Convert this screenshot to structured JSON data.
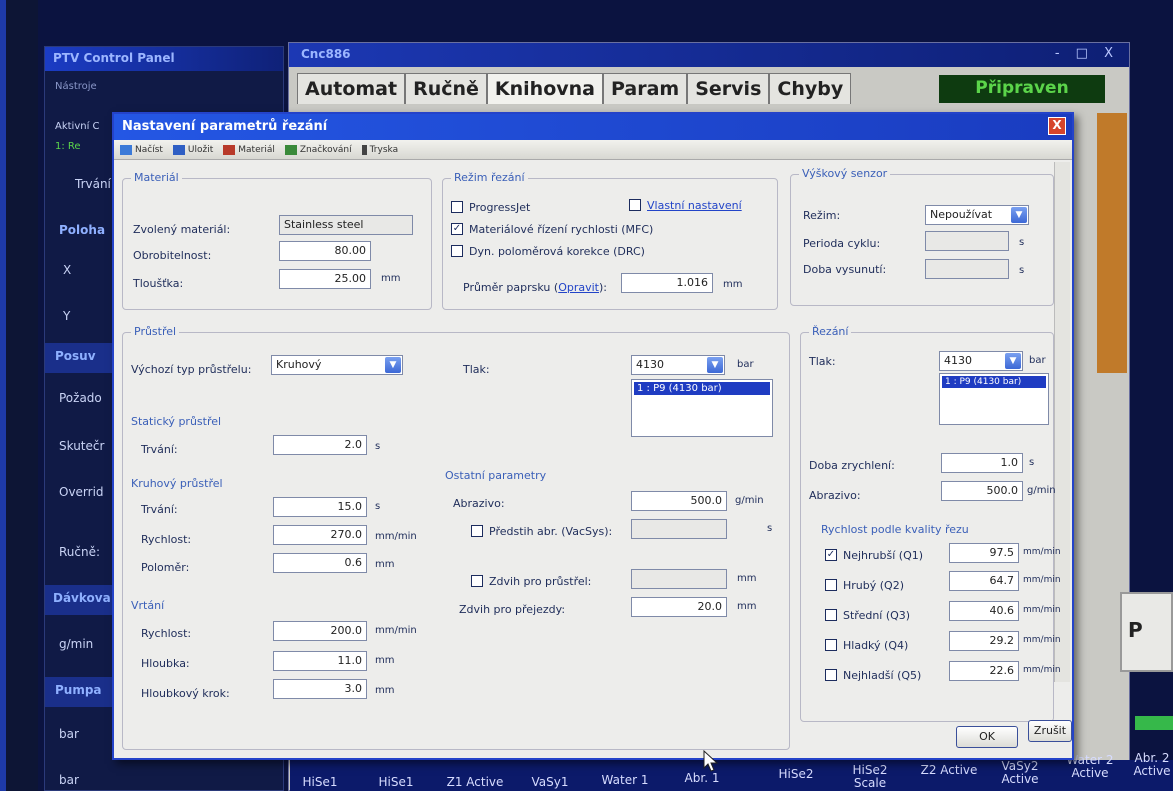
{
  "ptv": {
    "title": "PTV Control Panel",
    "rows": {
      "nastroje": "Nástroje",
      "aktivni": "Aktivní C",
      "one": "1:  Re",
      "trvani": "Trvání:",
      "poloha": "Poloha",
      "x": "X",
      "y": "Y",
      "posuv": "Posuv",
      "pozado": "Požado",
      "skutec": "Skutečr",
      "overrid": "Overrid",
      "rucne": "Ručně:",
      "davkova": "Dávkova",
      "gmin": "g/min",
      "pumpa": "Pumpa",
      "bar1": "bar",
      "bar2": "bar"
    }
  },
  "cnc": {
    "title": "Cnc886",
    "window_buttons": "- □ X",
    "tabs": [
      "Automat",
      "Ručně",
      "Knihovna",
      "Param",
      "Servis",
      "Chyby"
    ],
    "active_tab": 2,
    "status": "Připraven",
    "side_button": "P"
  },
  "bottom_bar": [
    {
      "l1": "HiSe1",
      "l2": ""
    },
    {
      "l1": "HiSe1",
      "l2": ""
    },
    {
      "l1": "Z1 Active",
      "l2": ""
    },
    {
      "l1": "VaSy1",
      "l2": ""
    },
    {
      "l1": "Water 1",
      "l2": ""
    },
    {
      "l1": "Abr. 1",
      "l2": ""
    },
    {
      "l1": "HiSe2",
      "l2": ""
    },
    {
      "l1": "HiSe2",
      "l2": "Scale"
    },
    {
      "l1": "Z2 Active",
      "l2": ""
    },
    {
      "l1": "VaSy2",
      "l2": "Active"
    },
    {
      "l1": "Water 2",
      "l2": "Active"
    },
    {
      "l1": "Abr. 2",
      "l2": "Active"
    }
  ],
  "dialog": {
    "title": "Nastavení parametrů řezání",
    "close": "X",
    "toolbar": [
      "Načíst",
      "Uložit",
      "Materiál",
      "Značkování",
      "Tryska"
    ],
    "material": {
      "legend": "Materiál",
      "zvoleny_label": "Zvolený materiál:",
      "zvoleny_value": "Stainless steel",
      "obrob_label": "Obrobitelnost:",
      "obrob_value": "80.00",
      "tloustka_label": "Tloušťka:",
      "tloustka_value": "25.00",
      "tloustka_unit": "mm"
    },
    "rezim": {
      "legend": "Režim řezání",
      "progressjet": "ProgressJet",
      "progressjet_checked": false,
      "vlastni": "Vlastní nastavení",
      "vlastni_checked": false,
      "mfc": "Materiálové řízení rychlosti (MFC)",
      "mfc_checked": true,
      "drc": "Dyn. poloměrová korekce (DRC)",
      "drc_checked": false,
      "prumer_label": "Průměr paprsku",
      "prumer_link": "Opravit",
      "prumer_value": "1.016",
      "prumer_unit": "mm"
    },
    "senzor": {
      "legend": "Výškový senzor",
      "rezim_label": "Režim:",
      "rezim_value": "Nepoužívat",
      "perioda_label": "Perioda cyklu:",
      "perioda_unit": "s",
      "doba_label": "Doba vysunutí:",
      "doba_unit": "s"
    },
    "prustrel": {
      "legend": "Průstřel",
      "typ_label": "Výchozí typ průstřelu:",
      "typ_value": "Kruhový",
      "staticky_head": "Statický průstřel",
      "st_trvani_label": "Trvání:",
      "st_trvani_value": "2.0",
      "st_trvani_unit": "s",
      "kruhovy_head": "Kruhový průstřel",
      "kr_trvani_label": "Trvání:",
      "kr_trvani_value": "15.0",
      "kr_trvani_unit": "s",
      "kr_rychlost_label": "Rychlost:",
      "kr_rychlost_value": "270.0",
      "kr_rychlost_unit": "mm/min",
      "kr_polomer_label": "Poloměr:",
      "kr_polomer_value": "0.6",
      "kr_polomer_unit": "mm",
      "vrtani_head": "Vrtání",
      "vr_rychlost_label": "Rychlost:",
      "vr_rychlost_value": "200.0",
      "vr_rychlost_unit": "mm/min",
      "vr_hloubka_label": "Hloubka:",
      "vr_hloubka_value": "11.0",
      "vr_hloubka_unit": "mm",
      "vr_krok_label": "Hloubkový krok:",
      "vr_krok_value": "3.0",
      "vr_krok_unit": "mm",
      "tlak_label": "Tlak:",
      "tlak_value": "4130",
      "tlak_unit": "bar",
      "tlak_list": [
        "1 :  P9    (4130 bar)"
      ],
      "ostatni_head": "Ostatní parametry",
      "abrazivo_label": "Abrazivo:",
      "abrazivo_value": "500.0",
      "abrazivo_unit": "g/min",
      "predstih_label": "Předstih abr. (VacSys):",
      "predstih_checked": false,
      "predstih_unit": "s",
      "zdvih_label": "Zdvih pro průstřel:",
      "zdvih_checked": false,
      "zdvih_unit": "mm",
      "prejezdy_label": "Zdvih pro přejezdy:",
      "prejezdy_value": "20.0",
      "prejezdy_unit": "mm"
    },
    "rezani": {
      "legend": "Řezání",
      "tlak_label": "Tlak:",
      "tlak_value": "4130",
      "tlak_unit": "bar",
      "tlak_list": [
        "1 :  P9    (4130 bar)"
      ],
      "zrychleni_label": "Doba zrychlení:",
      "zrychleni_value": "1.0",
      "zrychleni_unit": "s",
      "abrazivo_label": "Abrazivo:",
      "abrazivo_value": "500.0",
      "abrazivo_unit": "g/min",
      "kvalita_head": "Rychlost podle kvality řezu",
      "quality": [
        {
          "label": "Nejhrubší (Q1)",
          "value": "97.5",
          "unit": "mm/min",
          "checked": true
        },
        {
          "label": "Hrubý (Q2)",
          "value": "64.7",
          "unit": "mm/min",
          "checked": false
        },
        {
          "label": "Střední (Q3)",
          "value": "40.6",
          "unit": "mm/min",
          "checked": false
        },
        {
          "label": "Hladký (Q4)",
          "value": "29.2",
          "unit": "mm/min",
          "checked": false
        },
        {
          "label": "Nejhladší (Q5)",
          "value": "22.6",
          "unit": "mm/min",
          "checked": false
        }
      ]
    },
    "ok": "OK",
    "cancel": "Zrušit"
  },
  "colors": {
    "dialog_title": "#2457e4",
    "list_selection": "#1f3cc2",
    "ready_text": "#5bd44a"
  }
}
